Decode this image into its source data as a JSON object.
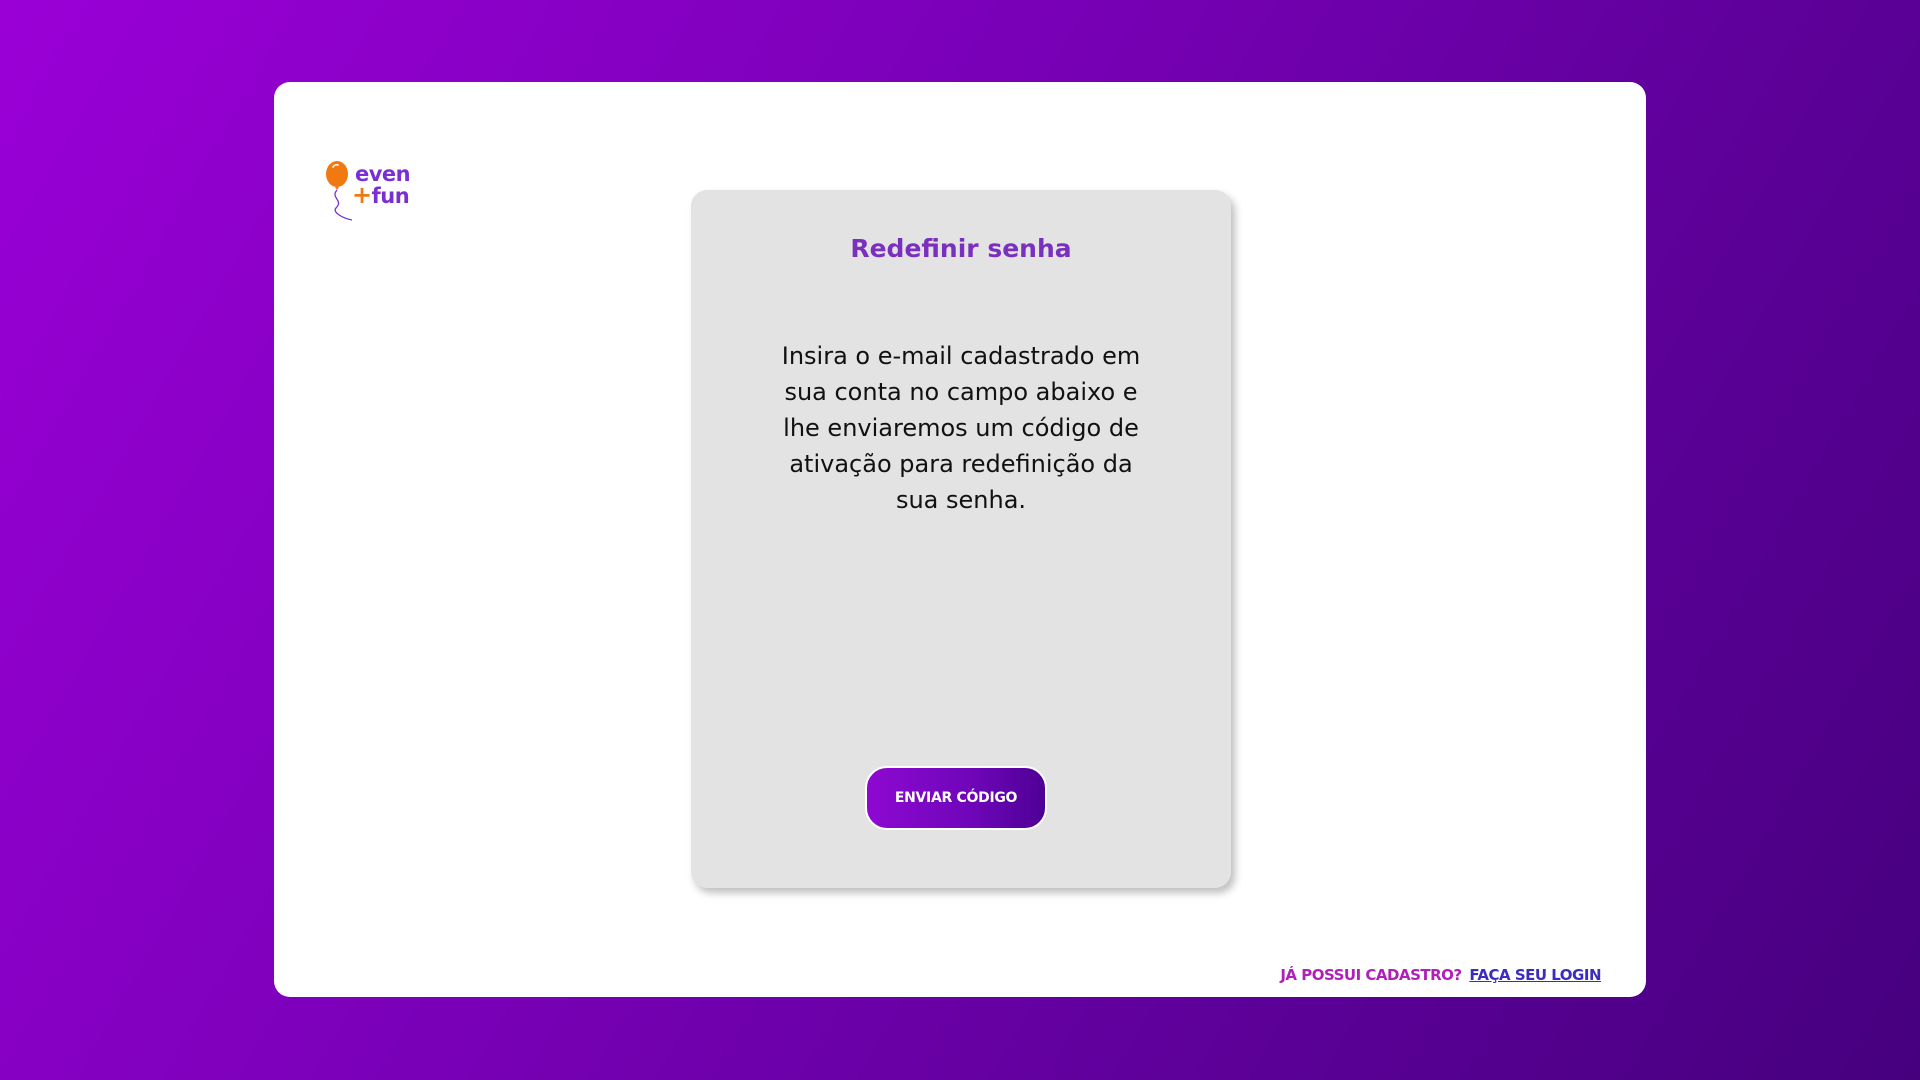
{
  "brand": {
    "logo_line1": "even",
    "logo_plus": "+",
    "logo_line2": "fun",
    "colors": {
      "purple": "#7b2fd0",
      "orange": "#f07a10"
    }
  },
  "form": {
    "title": "Redefinir senha",
    "description": "Insira o e-mail cadastrado em sua conta no campo abaixo e lhe enviaremos um código de ativação para redefinição da sua senha.",
    "submit_label": "ENVIAR CÓDIGO"
  },
  "footer": {
    "question": "JÁ POSSUI CADASTRO?",
    "login_link": "FAÇA SEU LOGIN"
  },
  "colors": {
    "background_start": "#9a00d6",
    "background_end": "#46007e",
    "card_bg": "#ffffff",
    "form_bg": "#e3e3e3",
    "title": "#7b2fbf",
    "button_start": "#8e08d2",
    "button_end": "#4e0096"
  }
}
